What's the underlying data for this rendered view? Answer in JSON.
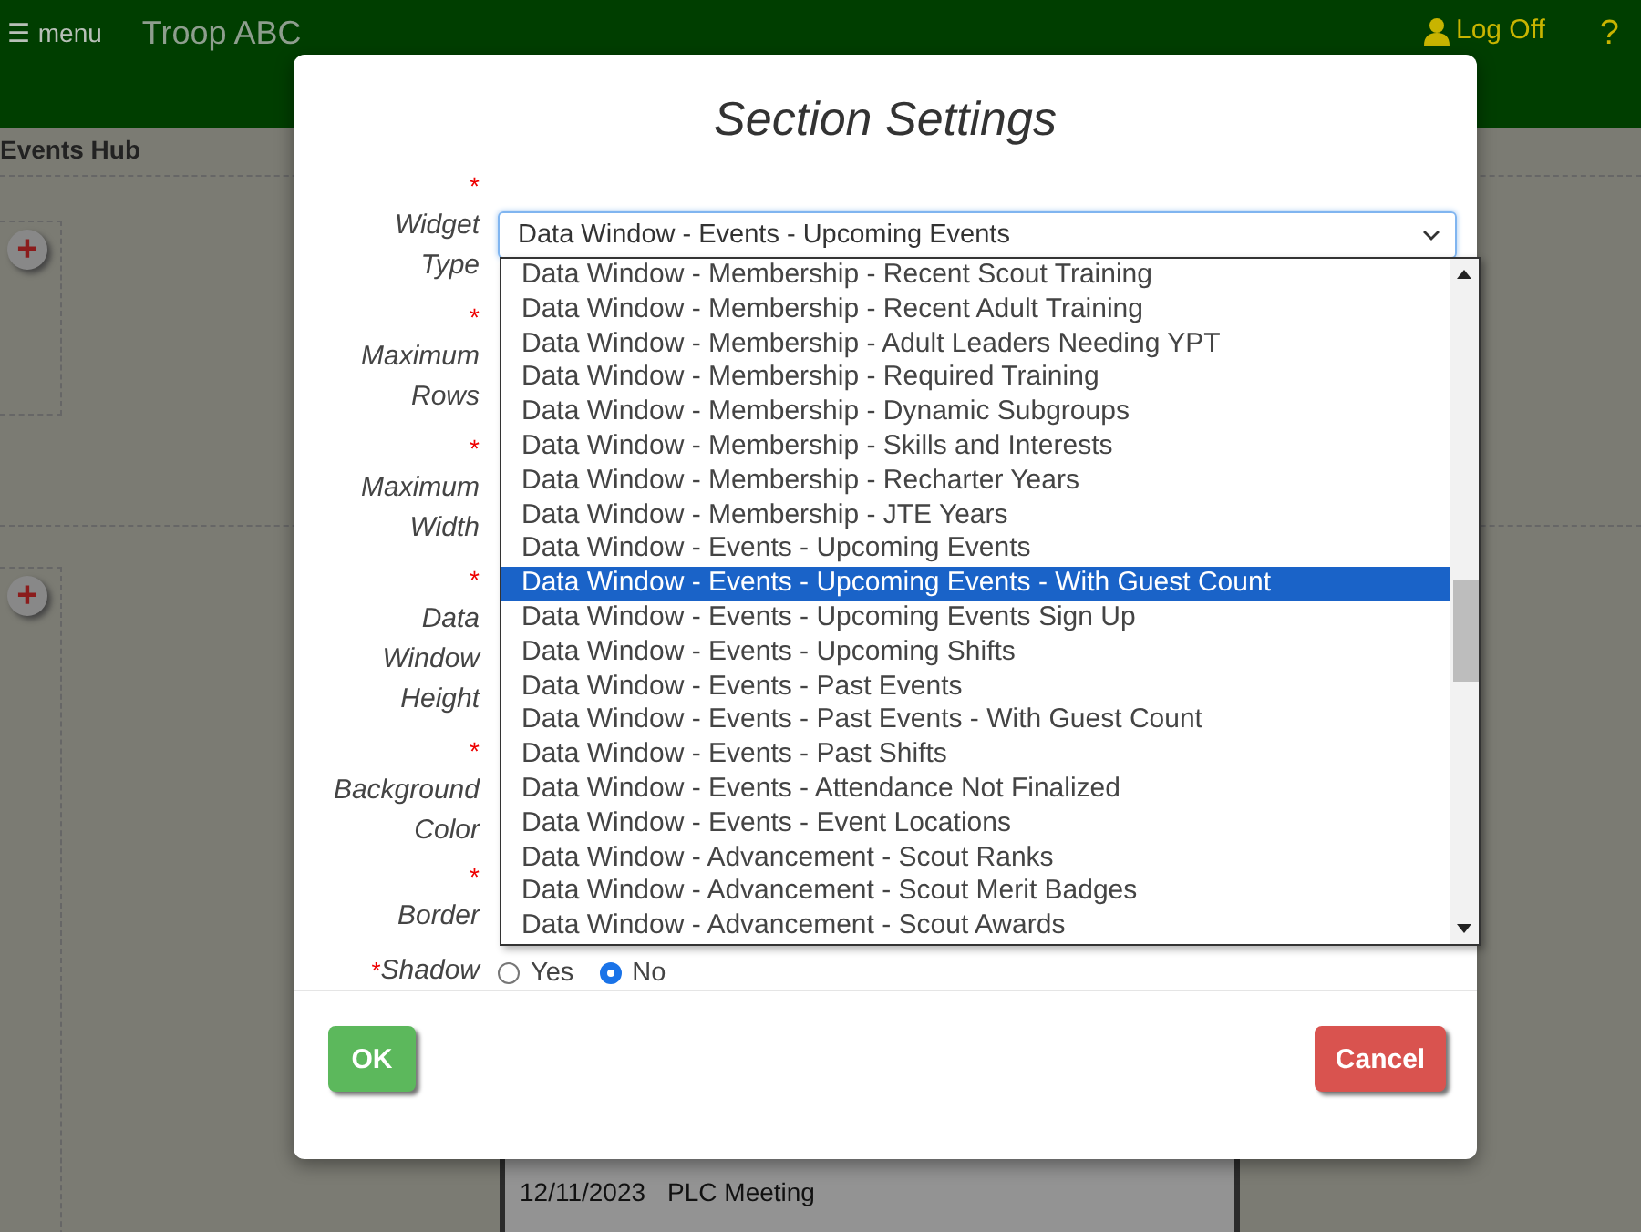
{
  "header": {
    "menu_icon": "☰",
    "menu_label": "menu",
    "title": "Troop ABC",
    "logoff": "Log Off",
    "help": "?"
  },
  "page": {
    "title": "Events Hub",
    "add_buttons": [
      "+",
      "+"
    ],
    "event_row": {
      "date": "12/11/2023",
      "name": "PLC Meeting"
    }
  },
  "dialog": {
    "title": "Section Settings",
    "fields": [
      {
        "label": "Widget Type",
        "required_mark": "*",
        "kind": "select",
        "value": "Data Window - Events - Upcoming Events"
      },
      {
        "label": "Maximum Rows",
        "required_mark": "*",
        "kind": "hidden"
      },
      {
        "label": "Maximum Width",
        "required_mark": "*",
        "kind": "hidden"
      },
      {
        "label": "Data Window Height",
        "required_mark": "*",
        "kind": "hidden"
      },
      {
        "label": "Background Color",
        "required_mark": "*",
        "kind": "hidden"
      },
      {
        "label": "Border",
        "required_mark": "*",
        "kind": "hidden"
      },
      {
        "label": "Shadow",
        "required_mark": "*",
        "kind": "radio",
        "options": [
          {
            "label": "Yes",
            "selected": false
          },
          {
            "label": "No",
            "selected": true
          }
        ]
      }
    ],
    "options": [
      {
        "label": "Data Window - Membership - Recent Scout Training",
        "selected": false
      },
      {
        "label": "Data Window - Membership - Recent Adult Training",
        "selected": false
      },
      {
        "label": "Data Window - Membership - Adult Leaders Needing YPT",
        "selected": false
      },
      {
        "label": "Data Window - Membership - Required Training",
        "selected": false
      },
      {
        "label": "Data Window - Membership - Dynamic Subgroups",
        "selected": false
      },
      {
        "label": "Data Window - Membership - Skills and Interests",
        "selected": false
      },
      {
        "label": "Data Window - Membership - Recharter Years",
        "selected": false
      },
      {
        "label": "Data Window - Membership - JTE Years",
        "selected": false
      },
      {
        "label": "Data Window - Events - Upcoming Events",
        "selected": false
      },
      {
        "label": "Data Window - Events - Upcoming Events - With Guest Count",
        "selected": true
      },
      {
        "label": "Data Window - Events - Upcoming Events Sign Up",
        "selected": false
      },
      {
        "label": "Data Window - Events - Upcoming Shifts",
        "selected": false
      },
      {
        "label": "Data Window - Events - Past Events",
        "selected": false
      },
      {
        "label": "Data Window - Events - Past Events - With Guest Count",
        "selected": false
      },
      {
        "label": "Data Window - Events - Past Shifts",
        "selected": false
      },
      {
        "label": "Data Window - Events - Attendance Not Finalized",
        "selected": false
      },
      {
        "label": "Data Window - Events - Event Locations",
        "selected": false
      },
      {
        "label": "Data Window - Advancement - Scout Ranks",
        "selected": false
      },
      {
        "label": "Data Window - Advancement - Scout Merit Badges",
        "selected": false
      },
      {
        "label": "Data Window - Advancement - Scout Awards",
        "selected": false
      }
    ],
    "buttons": {
      "ok": "OK",
      "cancel": "Cancel"
    }
  }
}
